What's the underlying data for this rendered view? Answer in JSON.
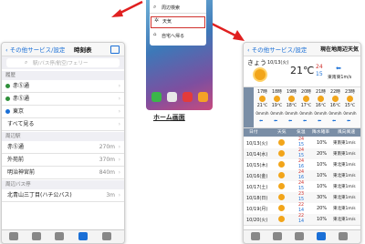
{
  "timetable": {
    "back_label": "その他サービス/設定",
    "title": "時刻表",
    "search_placeholder": "駅/バス停/航空/フェリー",
    "history_header": "履歴",
    "history": [
      {
        "name": "赤Ⓢ通",
        "sub": "",
        "color": "#2f8f3a"
      },
      {
        "name": "赤Ⓢ通",
        "sub": "",
        "color": "#2f8f3a"
      },
      {
        "name": "東京",
        "sub": "",
        "color": "#1a6fd6"
      }
    ],
    "see_all": "すべて見る",
    "nearby_header": "周辺駅",
    "stations": [
      {
        "name": "赤Ⓢ通",
        "dist": "270m"
      },
      {
        "name": "外苑前",
        "dist": "370m"
      },
      {
        "name": "明治神宮前",
        "dist": "840m"
      }
    ],
    "bus_header": "周辺バス停",
    "bus_stops": [
      {
        "name": "北青山三丁目(ハチ公バス)",
        "dist": "3m"
      }
    ]
  },
  "home": {
    "menu": [
      "周辺検索",
      "天気",
      "自宅へ帰る"
    ],
    "caption": "ホーム画面"
  },
  "weather": {
    "back_label": "その他サービス/設定",
    "title": "現在地周辺天気",
    "today_label": "きょう",
    "date": "10/13(火)",
    "temp": "21℃",
    "high": "24",
    "low": "15",
    "wind": "東南東1m/s",
    "hours": [
      "17時",
      "18時",
      "19時",
      "20時",
      "21時",
      "22時",
      "23時"
    ],
    "hour_temps": [
      "21℃",
      "19℃",
      "18℃",
      "17℃",
      "16℃",
      "16℃",
      "15℃"
    ],
    "rain": [
      "0mm/h",
      "0mm/h",
      "0mm/h",
      "0mm/h",
      "0mm/h",
      "0mm/h",
      "0mm/h"
    ],
    "header_cols": [
      "日付",
      "天気",
      "気温",
      "降水確率",
      "風向風速"
    ],
    "daily": [
      {
        "date": "10/13(火)",
        "hi": "24",
        "lo": "15",
        "pop": "10%",
        "wind": "東南東1m/s"
      },
      {
        "date": "10/14(水)",
        "hi": "24",
        "lo": "15",
        "pop": "20%",
        "wind": "東南東1m/s"
      },
      {
        "date": "10/15(木)",
        "hi": "24",
        "lo": "16",
        "pop": "10%",
        "wind": "東北東1m/s"
      },
      {
        "date": "10/16(金)",
        "hi": "24",
        "lo": "16",
        "pop": "10%",
        "wind": "東北東1m/s"
      },
      {
        "date": "10/17(土)",
        "hi": "24",
        "lo": "15",
        "pop": "10%",
        "wind": "東北東1m/s"
      },
      {
        "date": "10/18(日)",
        "hi": "23",
        "lo": "15",
        "pop": "30%",
        "wind": "東北東1m/s"
      },
      {
        "date": "10/19(月)",
        "hi": "22",
        "lo": "14",
        "pop": "20%",
        "wind": "東北東1m/s"
      },
      {
        "date": "10/20(火)",
        "hi": "22",
        "lo": "14",
        "pop": "10%",
        "wind": "東北東1m/s"
      }
    ]
  },
  "colors": {
    "accent": "#1a6fd6",
    "arrow": "#e02020",
    "highlight": "#d0312d",
    "sun": "#f2a51a"
  }
}
